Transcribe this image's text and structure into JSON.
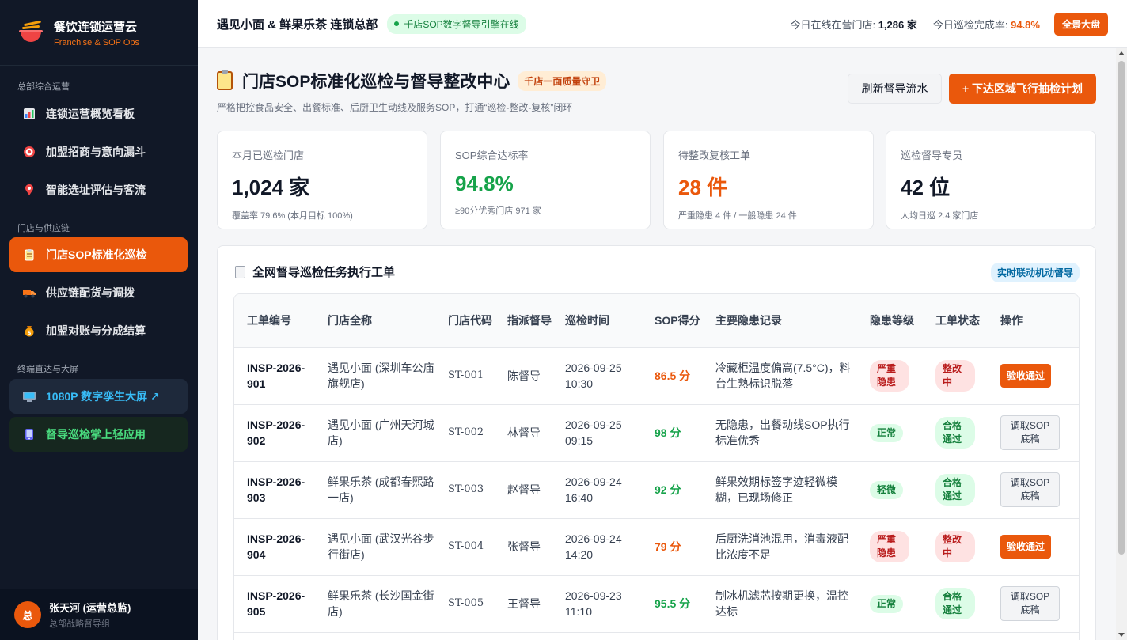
{
  "brand": {
    "title": "餐饮连锁运营云",
    "subtitle": "Franchise & SOP Ops"
  },
  "sidebar": {
    "sections": [
      "总部综合运营",
      "门店与供应链",
      "终端直达与大屏"
    ],
    "items": [
      {
        "label": "连锁运营概览看板",
        "icon": "bar-chart-icon"
      },
      {
        "label": "加盟招商与意向漏斗",
        "icon": "target-icon"
      },
      {
        "label": "智能选址评估与客流",
        "icon": "map-pin-icon"
      },
      {
        "label": "门店SOP标准化巡检",
        "icon": "clipboard-icon"
      },
      {
        "label": "供应链配货与调拨",
        "icon": "truck-icon"
      },
      {
        "label": "加盟对账与分成结算",
        "icon": "money-bag-icon"
      },
      {
        "label": "1080P 数字孪生大屏 ↗",
        "icon": "monitor-icon"
      },
      {
        "label": "督导巡检掌上轻应用",
        "icon": "phone-icon"
      }
    ]
  },
  "user": {
    "avatar": "总",
    "name": "张天河 (运营总监)",
    "role": "总部战略督导组"
  },
  "topbar": {
    "title": "遇见小面 & 鲜果乐茶 连锁总部",
    "engine_badge": "千店SOP数字督导引擎在线",
    "stores_label": "今日在线在营门店:",
    "stores_value": "1,286 家",
    "rate_label": "今日巡检完成率:",
    "rate_value": "94.8%",
    "dashboard_button": "全景大盘"
  },
  "page": {
    "title": "门店SOP标准化巡检与督导整改中心",
    "badge": "千店一面质量守卫",
    "subtitle": "严格把控食品安全、出餐标准、后厨卫生动线及服务SOP，打通“巡检-整改-复核”闭环",
    "refresh_button": "刷新督导流水",
    "plan_button": "+ 下达区域飞行抽检计划"
  },
  "kpis": [
    {
      "label": "本月已巡检门店",
      "value": "1,024 家",
      "note": "覆盖率 79.6% (本月目标 100%)"
    },
    {
      "label": "SOP综合达标率",
      "value": "94.8%",
      "note": "≥90分优秀门店 971 家"
    },
    {
      "label": "待整改复核工单",
      "value": "28 件",
      "note": "严重隐患 4 件 / 一般隐患 24 件"
    },
    {
      "label": "巡检督导专员",
      "value": "42 位",
      "note": "人均日巡 2.4 家门店"
    }
  ],
  "panel": {
    "title": "全网督导巡检任务执行工单",
    "live_badge": "实时联动机动督导",
    "columns": [
      "工单编号",
      "门店全称",
      "门店代码",
      "指派督导",
      "巡检时间",
      "SOP得分",
      "主要隐患记录",
      "隐患等级",
      "工单状态",
      "操作"
    ],
    "rows": [
      {
        "id": "INSP-2026-901",
        "store": "遇见小面 (深圳车公庙旗舰店)",
        "code": "ST-001",
        "inspector": "陈督导",
        "time": "2026-09-25 10:30",
        "score": "86.5 分",
        "issue": "冷藏柜温度偏高(7.5°C)，料台生熟标识脱落",
        "level": "严重隐患",
        "status": "整改中",
        "action": "验收通过"
      },
      {
        "id": "INSP-2026-902",
        "store": "遇见小面 (广州天河城店)",
        "code": "ST-002",
        "inspector": "林督导",
        "time": "2026-09-25 09:15",
        "score": "98 分",
        "issue": "无隐患，出餐动线SOP执行标准优秀",
        "level": "正常",
        "status": "合格通过",
        "action": "调取SOP底稿"
      },
      {
        "id": "INSP-2026-903",
        "store": "鲜果乐茶 (成都春熙路一店)",
        "code": "ST-003",
        "inspector": "赵督导",
        "time": "2026-09-24 16:40",
        "score": "92 分",
        "issue": "鲜果效期标签字迹轻微模糊，已现场修正",
        "level": "轻微",
        "status": "合格通过",
        "action": "调取SOP底稿"
      },
      {
        "id": "INSP-2026-904",
        "store": "遇见小面 (武汉光谷步行街店)",
        "code": "ST-004",
        "inspector": "张督导",
        "time": "2026-09-24 14:20",
        "score": "79 分",
        "issue": "后厨洗消池混用，消毒液配比浓度不足",
        "level": "严重隐患",
        "status": "整改中",
        "action": "验收通过"
      },
      {
        "id": "INSP-2026-905",
        "store": "鲜果乐茶 (长沙国金街店)",
        "code": "ST-005",
        "inspector": "王督导",
        "time": "2026-09-23 11:10",
        "score": "95.5 分",
        "issue": "制冰机滤芯按期更换，温控达标",
        "level": "正常",
        "status": "合格通过",
        "action": "调取SOP底稿"
      }
    ]
  },
  "colors": {
    "accent": "#ea580c",
    "sidebar": "#111827",
    "success": "#16a34a",
    "danger": "#b91c1c"
  }
}
